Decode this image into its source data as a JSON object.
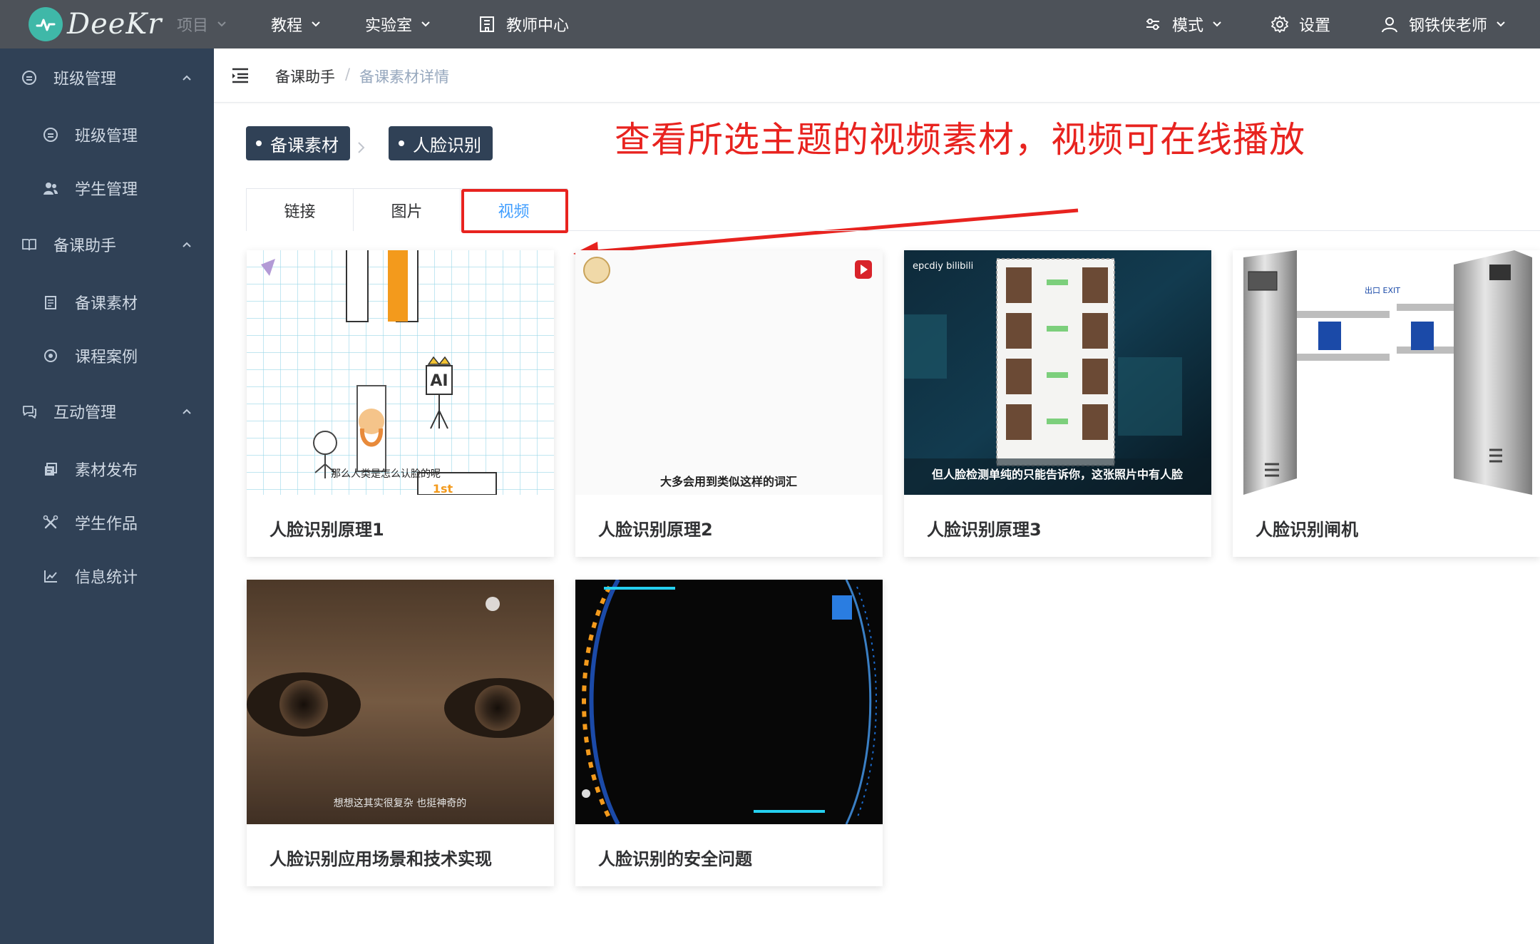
{
  "app": {
    "logo_text": "DeeKr"
  },
  "topnav": {
    "project": "项目",
    "tutorial": "教程",
    "lab": "实验室",
    "teacher_center": "教师中心",
    "mode": "模式",
    "settings": "设置",
    "user": "钢铁侠老师"
  },
  "sidebar": {
    "groups": [
      {
        "label": "班级管理",
        "items": [
          "班级管理",
          "学生管理"
        ]
      },
      {
        "label": "备课助手",
        "items": [
          "备课素材",
          "课程案例"
        ]
      },
      {
        "label": "互动管理",
        "items": [
          "素材发布",
          "学生作品",
          "信息统计"
        ]
      }
    ]
  },
  "breadcrumb": {
    "first": "备课助手",
    "separator": "/",
    "current": "备课素材详情"
  },
  "tags": {
    "first": "备课素材",
    "second": "人脸识别"
  },
  "annotation": "查看所选主题的视频素材，视频可在线播放",
  "tabs": [
    "链接",
    "图片",
    "视频"
  ],
  "active_tab": "视频",
  "videos": [
    {
      "title": "人脸识别原理1",
      "caption": "那么人类是怎么认脸的呢",
      "thumb_text": "AI",
      "thumb_text2": "1st"
    },
    {
      "title": "人脸识别原理2",
      "caption": "大多会用到类似这样的词汇"
    },
    {
      "title": "人脸识别原理3",
      "caption": "但人脸检测单纯的只能告诉你，这张照片中有人脸",
      "thumb_text": "epcdiy bilibili"
    },
    {
      "title": "人脸识别闸机",
      "thumb_text": "出口 EXIT"
    },
    {
      "title": "人脸识别应用场景和技术实现",
      "caption": "想想这其实很复杂 也挺神奇的"
    },
    {
      "title": "人脸识别的安全问题"
    }
  ],
  "colors": {
    "topbar": "#4d5259",
    "sidebar": "#304156",
    "accent": "#409eff",
    "annotation": "#e8231f"
  }
}
